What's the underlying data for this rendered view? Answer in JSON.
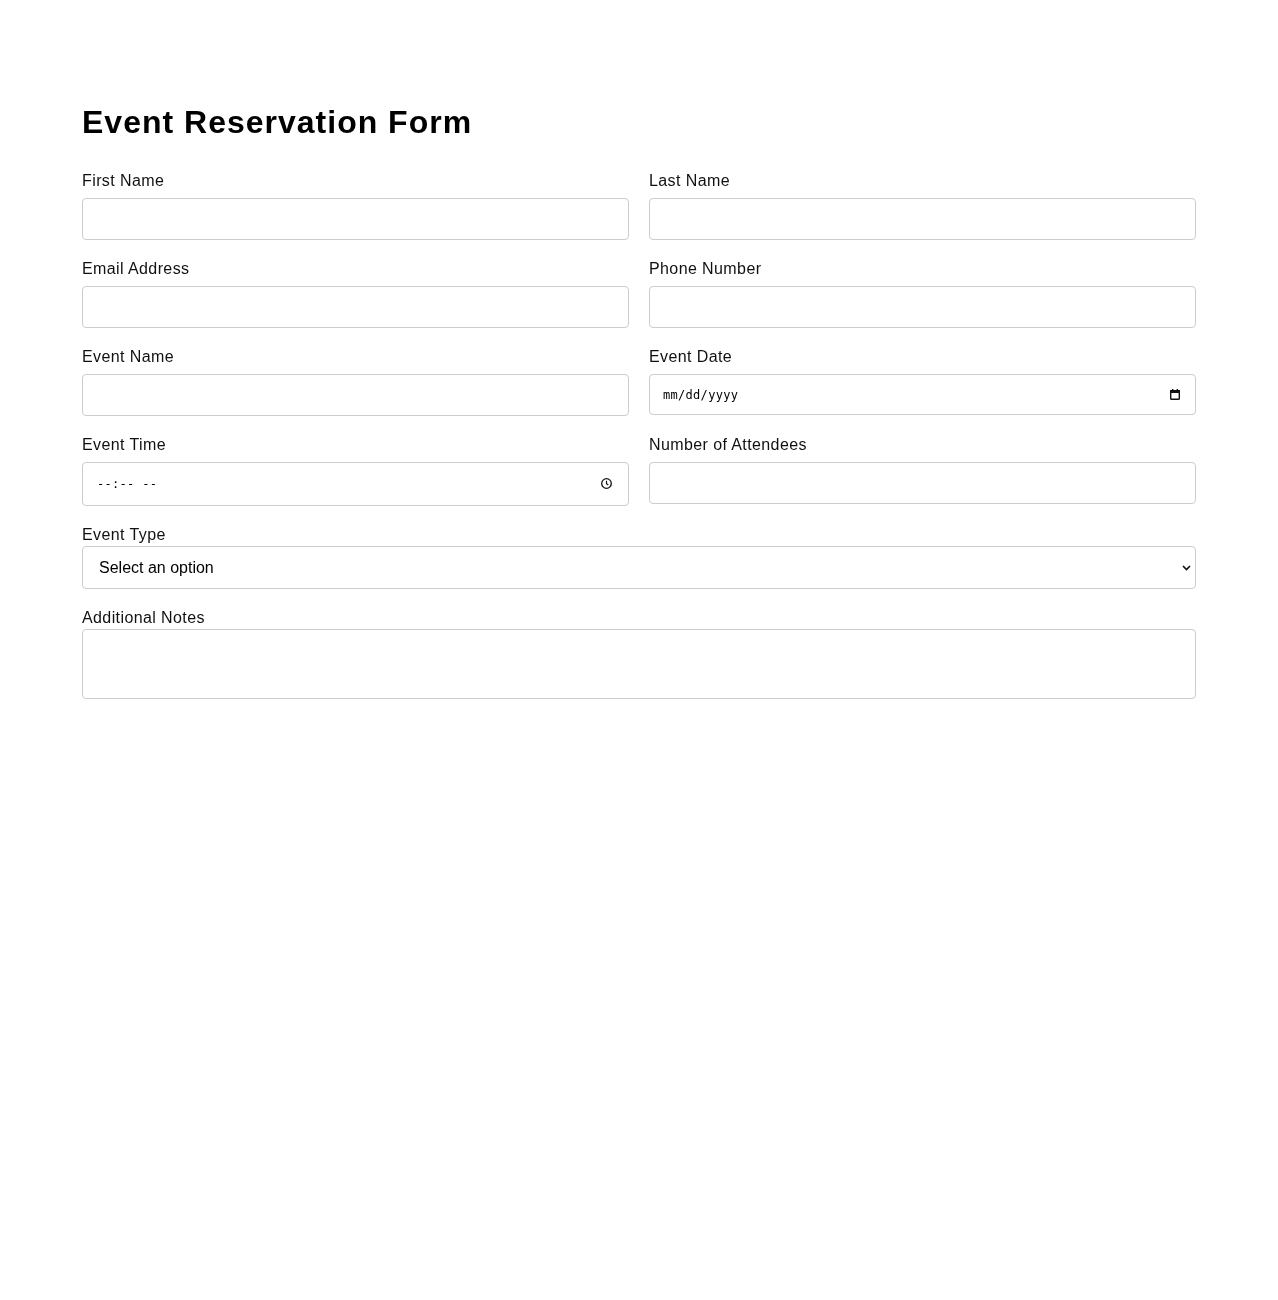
{
  "title": "Event Reservation Form",
  "fields": [
    {
      "kind": "text",
      "label": "First Name"
    },
    {
      "kind": "text",
      "label": "Last Name"
    },
    {
      "kind": "text",
      "label": "Email Address"
    },
    {
      "kind": "text",
      "label": "Phone Number"
    },
    {
      "kind": "text",
      "label": "Event Name"
    },
    {
      "kind": "date",
      "label": "Event Date",
      "placeholder": "mm/dd/yyyy"
    },
    {
      "kind": "time",
      "label": "Event Time",
      "placeholder": "--:-- --"
    },
    {
      "kind": "text",
      "label": "Number of Attendees"
    },
    {
      "kind": "select",
      "label": "Event Type",
      "value": "Select an option"
    },
    {
      "kind": "textarea",
      "label": "Additional Notes"
    }
  ]
}
